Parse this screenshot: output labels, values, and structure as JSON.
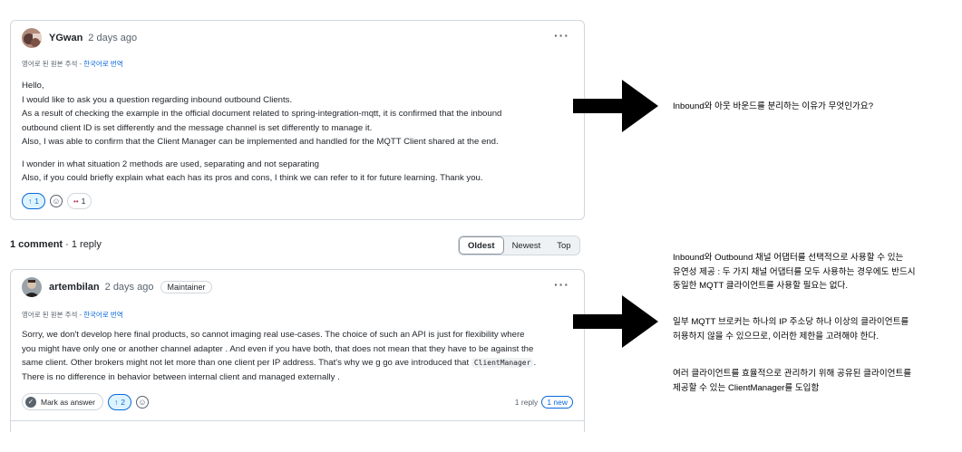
{
  "question": {
    "author": "YGwan",
    "time": "2 days ago",
    "translation_note": "영어로 된 원본 주석 - ",
    "translate_link": "한국어로 번역",
    "lines": [
      "Hello,",
      "I would like to ask you a question regarding inbound outbound Clients.",
      "As a result of checking the example in the official document related to spring-integration-mqtt, it is confirmed that the inbound",
      "outbound client ID is set differently and the message channel is set differently to manage it.",
      "Also, I was able to confirm that the Client Manager can be implemented and handled for the MQTT Client shared at the end."
    ],
    "lines2": [
      "I wonder in what situation 2 methods are used, separating and not separating",
      "Also, if you could briefly explain what each has its pros and cons, I think we can refer to it for future learning. Thank you."
    ],
    "upvote_arrow": "↑",
    "upvotes": "1",
    "eyes_emoji": "••",
    "eyes_count": "1",
    "more": "···"
  },
  "summary": {
    "comments": "1 comment",
    "replies": " · 1 reply"
  },
  "sort": {
    "oldest": "Oldest",
    "newest": "Newest",
    "top": "Top"
  },
  "reply": {
    "author": "artembilan",
    "time": "2 days ago",
    "badge": "Maintainer",
    "translation_note": "영어로 된 원본 주석 - ",
    "translate_link": "한국어로 번역",
    "line1": "Sorry, we don't develop here final products, so cannot imaging real use-cases. The choice of such an API is just for flexibility where",
    "line2": "you might have only one or another channel adapter . And even if you have both, that does not mean that they have to be against the",
    "line3_pre": "same client. Other brokers might not let more than one client per IP address. That's why we g go ave introduced that ",
    "line3_code": "ClientManager",
    "line3_post": ".",
    "line4": "There is no difference in behavior between internal client and managed externally .",
    "mark_answer": "Mark as answer",
    "upvote_arrow": "↑",
    "upvotes": "2",
    "reply_count": "1 reply",
    "new_count": "1 new",
    "more": "···"
  },
  "notes": {
    "n1": "Inbound와 아웃 바운드를 분리하는 이유가 무엇인가요?",
    "n2": [
      "Inbound와 Outbound 채널 어댑터를 선택적으로 사용할 수 있는",
      "유연성 제공 : 두 가지 채널 어댑터를 모두 사용하는 경우에도 반드시",
      "동일한 MQTT 클라이언트를 사용할 필요는 없다."
    ],
    "n3": [
      "일부 MQTT 브로커는 하나의 IP 주소당 하나 이상의 클라이언트를",
      "허용하지 않을 수 있으므로, 이러한 제한을 고려해야 한다."
    ],
    "n4": [
      "여러 클라이언트를 효율적으로 관리하기 위해 공유된 클라이언트를",
      "제공할 수 있는 ClientManager를 도입함"
    ]
  },
  "colors": {
    "accent": "#0969da",
    "border": "#d0d7de",
    "muted": "#59636e"
  }
}
